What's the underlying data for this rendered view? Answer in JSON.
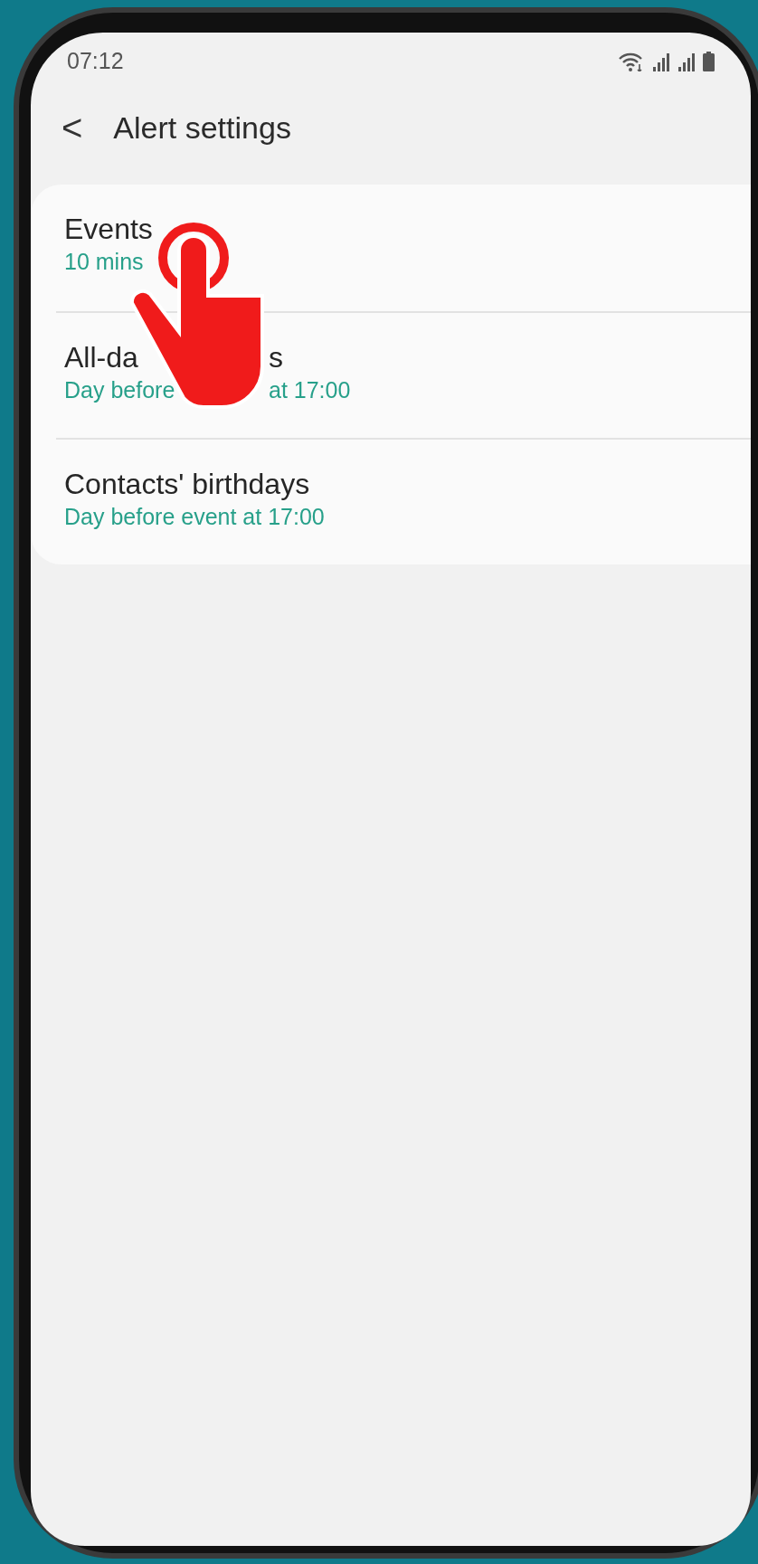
{
  "status_bar": {
    "time": "07:12"
  },
  "header": {
    "back": "<",
    "title": "Alert settings"
  },
  "items": [
    {
      "title_parts": [
        "Events"
      ],
      "subtitle_parts": [
        "10 mins"
      ]
    },
    {
      "title_parts": [
        "All-da",
        "s"
      ],
      "subtitle_parts": [
        "Day before",
        "at 17:00"
      ]
    },
    {
      "title_parts": [
        "Contacts' birthdays"
      ],
      "subtitle_parts": [
        "Day before event at 17:00"
      ]
    }
  ]
}
